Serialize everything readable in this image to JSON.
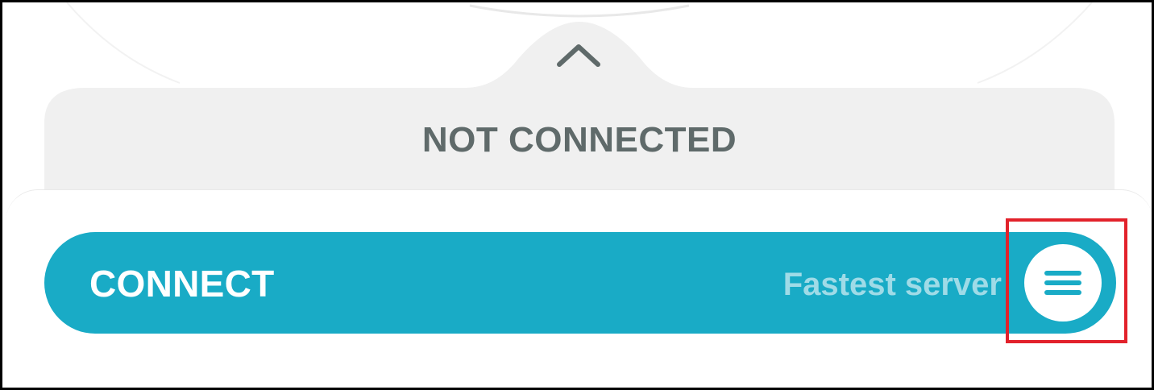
{
  "status": {
    "text": "NOT CONNECTED"
  },
  "connect_bar": {
    "label": "CONNECT",
    "server": "Fastest server"
  },
  "icons": {
    "collapse": "chevron-up-icon",
    "menu": "hamburger-menu-icon"
  },
  "colors": {
    "accent": "#19abc6",
    "server_text": "#9fdbe7",
    "status_text": "#5f6a6a",
    "panel_bg": "#f0f0f0",
    "highlight": "#e2222b"
  }
}
